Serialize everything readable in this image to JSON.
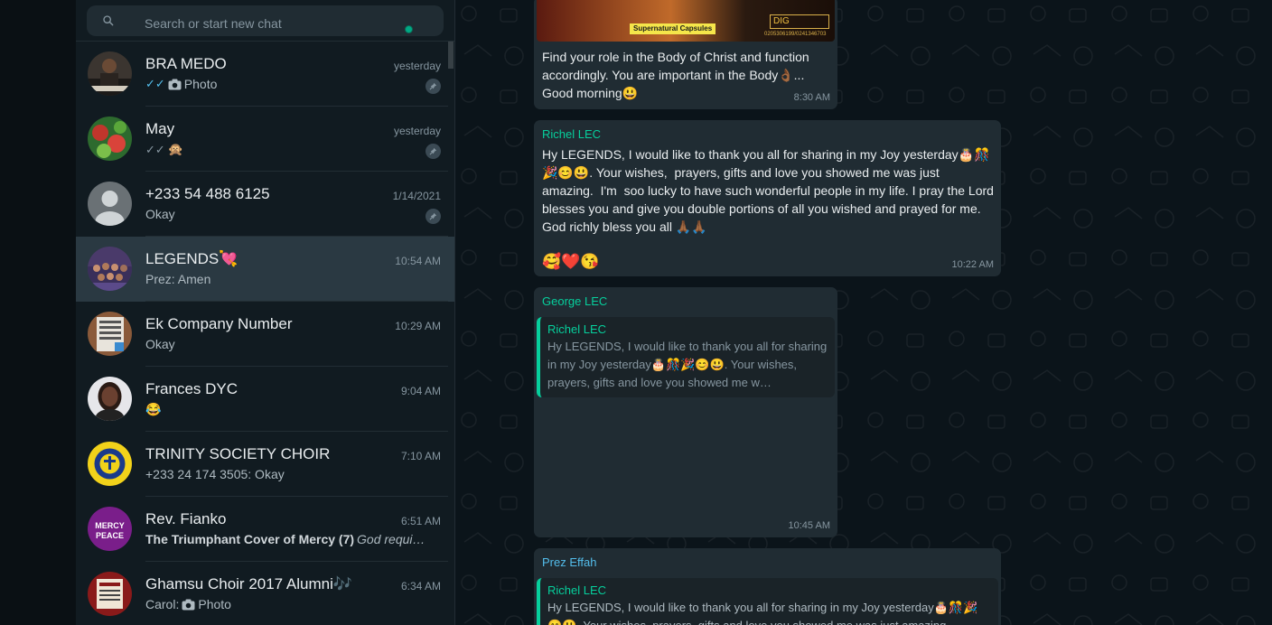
{
  "search": {
    "placeholder": "Search or start new chat"
  },
  "chats": [
    {
      "name": "BRA MEDO",
      "time": "yesterday",
      "preview": "Photo",
      "status_icon": "double-check-blue",
      "media_icon": "camera-icon",
      "pinned": true
    },
    {
      "name": "May",
      "time": "yesterday",
      "preview": "🙊",
      "status_icon": "double-check-grey",
      "pinned": true
    },
    {
      "name": "+233 54 488 6125",
      "time": "1/14/2021",
      "preview": "Okay",
      "pinned": true
    },
    {
      "name": "LEGENDS💘",
      "time": "10:54 AM",
      "preview": "Prez: Amen",
      "active": true
    },
    {
      "name": "Ek Company Number",
      "time": "10:29 AM",
      "preview": "Okay"
    },
    {
      "name": "Frances DYC",
      "time": "9:04 AM",
      "preview": "😂"
    },
    {
      "name": "TRINITY SOCIETY CHOIR",
      "time": "7:10 AM",
      "preview": "+233 24 174 3505: Okay"
    },
    {
      "name": "Rev. Fianko",
      "time": "6:51 AM",
      "preview_bold": "The Triumphant Cover of Mercy (7)",
      "preview_italic": "God requi…"
    },
    {
      "name": "Ghamsu Choir 2017 Alumni🎶",
      "time": "6:34 AM",
      "preview_prefix": "Carol:",
      "preview": "Photo",
      "media_icon": "camera-icon"
    }
  ],
  "avatars": {
    "rev_fianko": {
      "line1": "MERCY",
      "line2": "PEACE"
    }
  },
  "messages": [
    {
      "image_caption": "Supernatural Capsules",
      "image_badge": "DIG",
      "image_contact": "0205306199/0241346703",
      "text_line1": "Find your role in the Body of Christ and function",
      "text_line2": "accordingly. You are important in the Body👌🏾...",
      "text_line3": "Good morning😃",
      "time": "8:30 AM"
    },
    {
      "sender": "Richel LEC",
      "sender_color": "#06cf9c",
      "text": "Hy LEGENDS, I would like to thank you all for sharing in my Joy yesterday🎂🎊🎉😊😃. Your wishes,  prayers, gifts and love you showed me was just amazing.  I'm  soo lucky to have such wonderful people in my life. I pray the Lord blesses you and give you double portions of all you wished and prayed for me. God richly bless you all 🙏🏾🙏🏾",
      "emojis": "🥰❤️😘",
      "time": "10:22 AM"
    },
    {
      "sender": "George LEC",
      "sender_color": "#06cf9c",
      "quote_sender": "Richel LEC",
      "quote_text": "Hy LEGENDS, I would like to thank you all for sharing in my Joy yesterday🎂🎊🎉😊😃. Your wishes,  prayers, gifts and love you showed me w…",
      "time": "10:45 AM"
    },
    {
      "sender": "Prez Effah",
      "sender_color": "#53bdeb",
      "quote_sender": "Richel LEC",
      "quote_text": "Hy LEGENDS, I would like to thank you all for sharing in my Joy yesterday🎂🎊🎉😊😃. Your wishes, prayers, gifts and love you showed me was just amazing."
    }
  ]
}
